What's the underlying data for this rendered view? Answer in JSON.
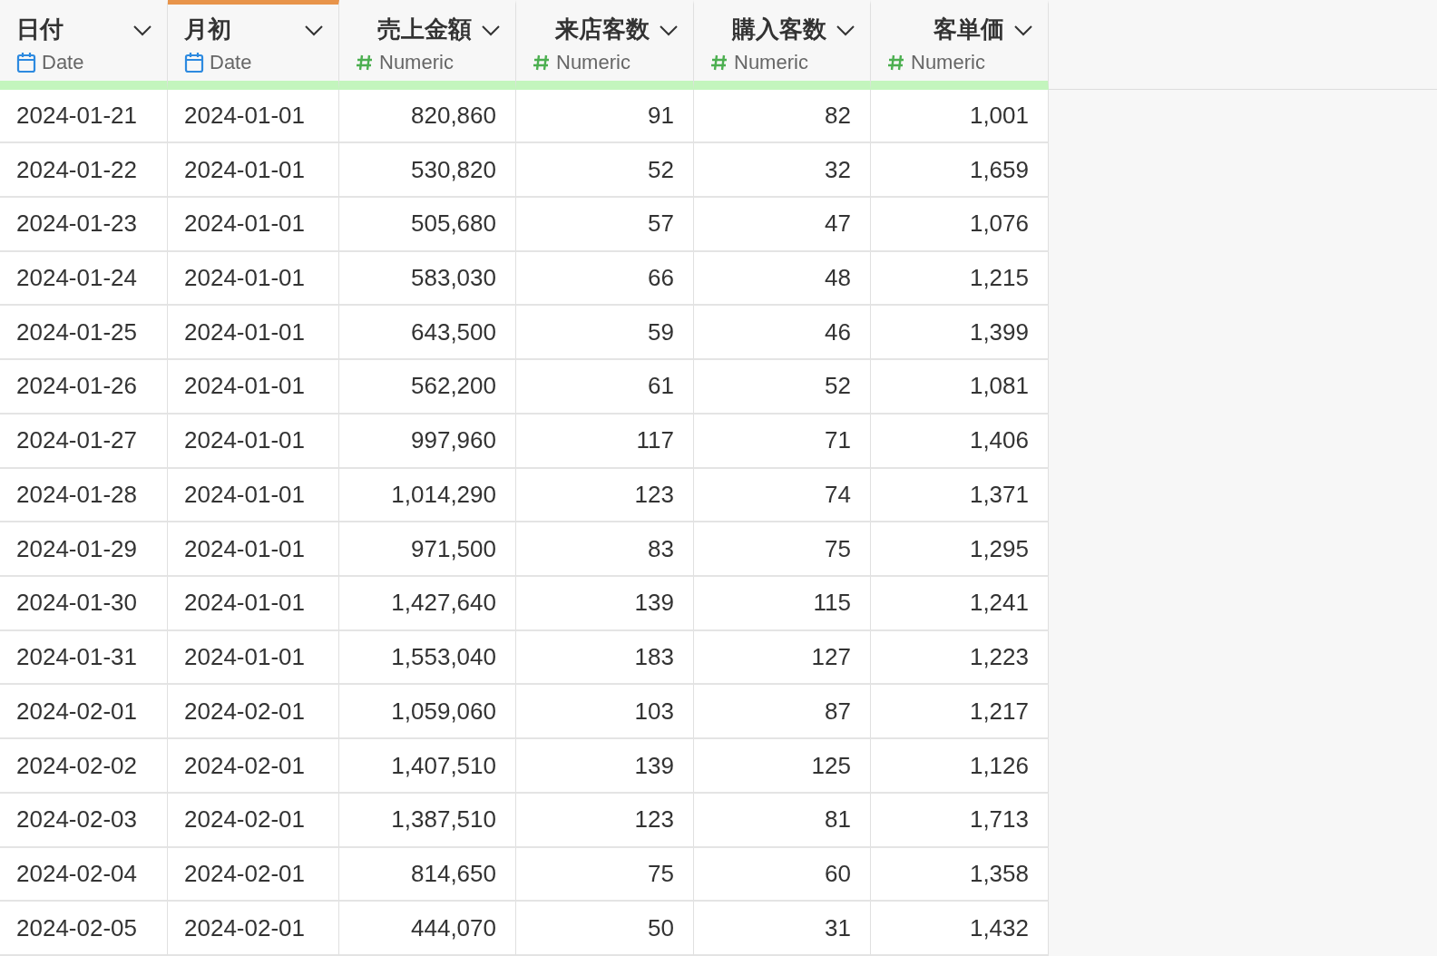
{
  "table": {
    "columns": [
      {
        "name": "日付",
        "type": "Date",
        "kind": "date",
        "selected": false
      },
      {
        "name": "月初",
        "type": "Date",
        "kind": "date",
        "selected": true
      },
      {
        "name": "売上金額",
        "type": "Numeric",
        "kind": "numeric",
        "selected": false
      },
      {
        "name": "来店客数",
        "type": "Numeric",
        "kind": "numeric",
        "selected": false
      },
      {
        "name": "購入客数",
        "type": "Numeric",
        "kind": "numeric",
        "selected": false
      },
      {
        "name": "客単価",
        "type": "Numeric",
        "kind": "numeric",
        "selected": false
      }
    ],
    "rows": [
      [
        "2024-01-21",
        "2024-01-01",
        "820,860",
        "91",
        "82",
        "1,001"
      ],
      [
        "2024-01-22",
        "2024-01-01",
        "530,820",
        "52",
        "32",
        "1,659"
      ],
      [
        "2024-01-23",
        "2024-01-01",
        "505,680",
        "57",
        "47",
        "1,076"
      ],
      [
        "2024-01-24",
        "2024-01-01",
        "583,030",
        "66",
        "48",
        "1,215"
      ],
      [
        "2024-01-25",
        "2024-01-01",
        "643,500",
        "59",
        "46",
        "1,399"
      ],
      [
        "2024-01-26",
        "2024-01-01",
        "562,200",
        "61",
        "52",
        "1,081"
      ],
      [
        "2024-01-27",
        "2024-01-01",
        "997,960",
        "117",
        "71",
        "1,406"
      ],
      [
        "2024-01-28",
        "2024-01-01",
        "1,014,290",
        "123",
        "74",
        "1,371"
      ],
      [
        "2024-01-29",
        "2024-01-01",
        "971,500",
        "83",
        "75",
        "1,295"
      ],
      [
        "2024-01-30",
        "2024-01-01",
        "1,427,640",
        "139",
        "115",
        "1,241"
      ],
      [
        "2024-01-31",
        "2024-01-01",
        "1,553,040",
        "183",
        "127",
        "1,223"
      ],
      [
        "2024-02-01",
        "2024-02-01",
        "1,059,060",
        "103",
        "87",
        "1,217"
      ],
      [
        "2024-02-02",
        "2024-02-01",
        "1,407,510",
        "139",
        "125",
        "1,126"
      ],
      [
        "2024-02-03",
        "2024-02-01",
        "1,387,510",
        "123",
        "81",
        "1,713"
      ],
      [
        "2024-02-04",
        "2024-02-01",
        "814,650",
        "75",
        "60",
        "1,358"
      ],
      [
        "2024-02-05",
        "2024-02-01",
        "444,070",
        "50",
        "31",
        "1,432"
      ]
    ]
  }
}
